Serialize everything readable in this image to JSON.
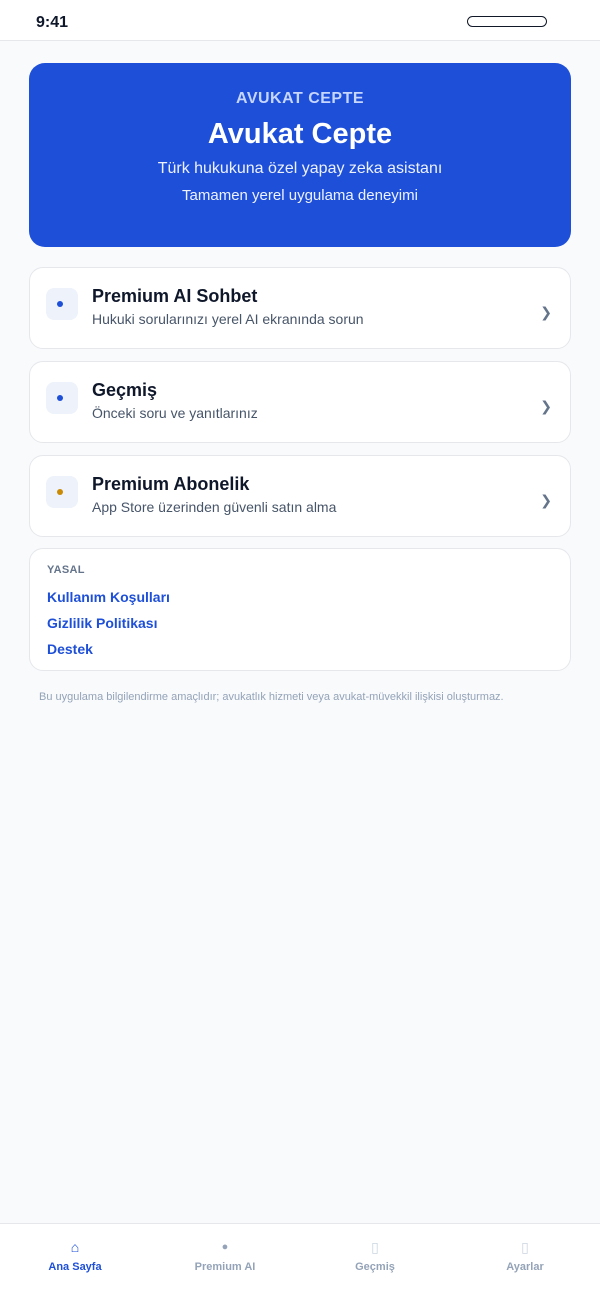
{
  "status_bar": {
    "time": "9:41"
  },
  "hero": {
    "eyebrow": "AVUKAT CEPTE",
    "title": "Avukat Cepte",
    "subtitle": "Türk hukukuna özel yapay zeka asistanı",
    "subtitle2": "Tamamen yerel uygulama deneyimi"
  },
  "cards": [
    {
      "title": "Premium AI Sohbet",
      "subtitle": "Hukuki sorularınızı yerel AI ekranında sorun",
      "icon": "chat-dot-icon",
      "dot_color": "#1d4fd8",
      "chevron": "❯"
    },
    {
      "title": "Geçmiş",
      "subtitle": "Önceki soru ve yanıtlarınız",
      "icon": "history-dot-icon",
      "dot_color": "#1d4fd8",
      "chevron": "❯"
    },
    {
      "title": "Premium Abonelik",
      "subtitle": "App Store üzerinden güvenli satın alma",
      "icon": "premium-dot-icon",
      "dot_color": "#ca8a04",
      "chevron": "❯"
    }
  ],
  "legal": {
    "heading": "YASAL",
    "links": [
      "Kullanım Koşulları",
      "Gizlilik Politikası",
      "Destek"
    ]
  },
  "disclaimer": "Bu uygulama bilgilendirme amaçlıdır; avukatlık hizmeti veya avukat-müvekkil ilişkisi oluşturmaz.",
  "tabbar": {
    "tabs": [
      {
        "label": "Ana Sayfa",
        "icon": "home-icon",
        "glyph": "⌂",
        "active": true
      },
      {
        "label": "Premium AI",
        "icon": "dot-icon",
        "glyph": "●",
        "active": false
      },
      {
        "label": "Geçmiş",
        "icon": "square-icon",
        "glyph": "▯",
        "active": false
      },
      {
        "label": "Ayarlar",
        "icon": "square-icon",
        "glyph": "▯",
        "active": false
      }
    ],
    "active_color": "#1d4fd8",
    "inactive_color": "#94a3b8"
  },
  "colors": {
    "accent": "#1d4fd8",
    "background": "#f8fafc"
  }
}
